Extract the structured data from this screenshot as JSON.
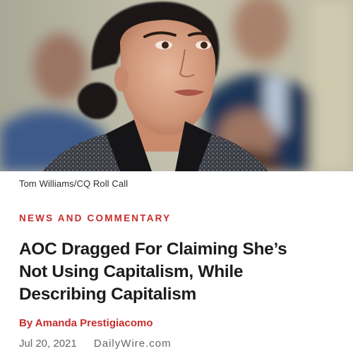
{
  "article": {
    "photo_alt": "Photo of Alexandria Ocasio-Cortez",
    "photo_credit": "Tom Williams/CQ Roll Call",
    "category": "NEWS AND COMMENTARY",
    "headline_lines": [
      "AOC Dragged For Claiming She’s",
      "Not Using Capitalism, While",
      "Describing Capitalism"
    ],
    "byline": "By Amanda Prestigiacomo",
    "date": "Jul 20, 2021",
    "source": "DailyWire.com"
  }
}
